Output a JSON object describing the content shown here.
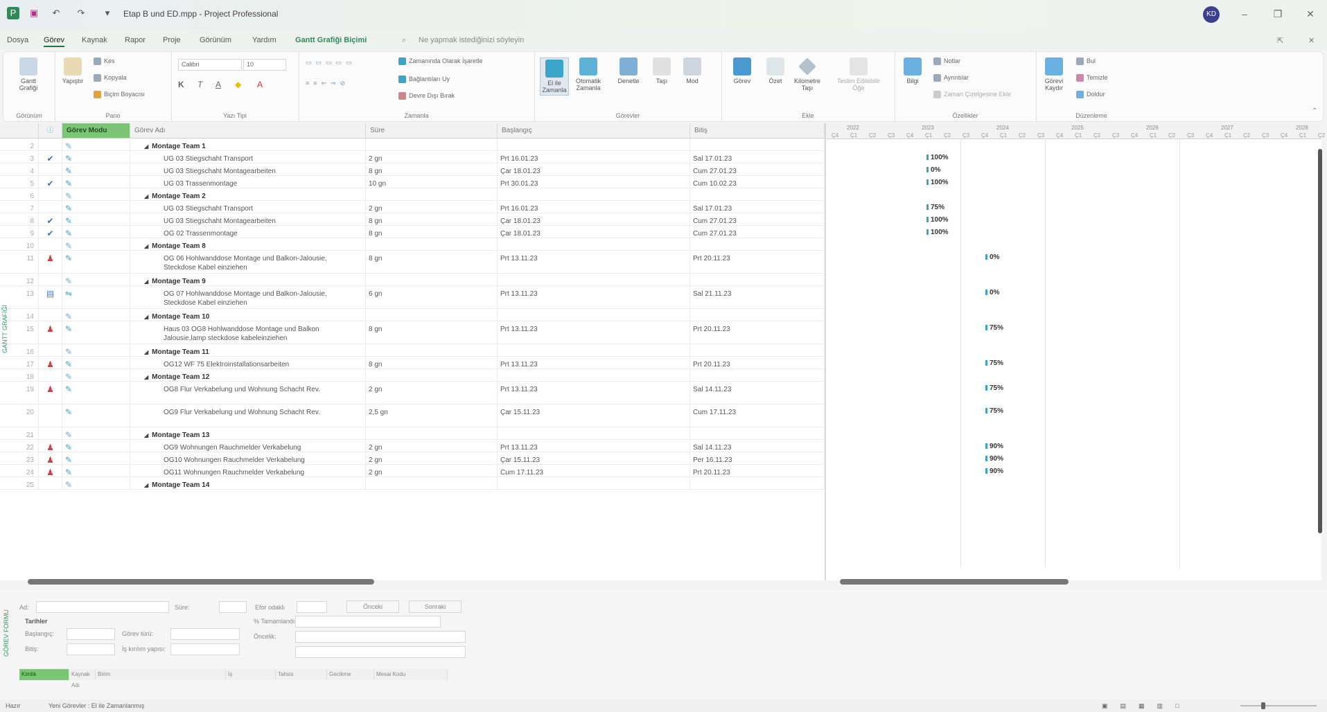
{
  "window": {
    "title": "Etap B und ED.mpp - Project Professional",
    "avatar_initials": "KD"
  },
  "menu": {
    "tabs": [
      "Dosya",
      "Görev",
      "Kaynak",
      "Rapor",
      "Proje",
      "Görünüm",
      "Yardım",
      "Gantt Grafiği Biçimi"
    ],
    "search_placeholder": "Ne yapmak istediğinizi söyleyin"
  },
  "ribbon": {
    "groups": {
      "view": {
        "label": "Görünüm",
        "gantt": "Gantt Grafiği"
      },
      "clipboard": {
        "label": "Pano",
        "paste": "Yapıştır",
        "cut": "Kes",
        "copy": "Kopyala",
        "format_painter": "Biçim Boyacısı"
      },
      "font": {
        "label": "Yazı Tipi",
        "font_name": "Calibri",
        "font_size": "10"
      },
      "schedule": {
        "label": "Zamanla",
        "respect_links": "Zamanında Olarak İşaretle",
        "link": "Bağlantıları Uy",
        "inactivate": "Devre Dışı Bırak"
      },
      "tasks": {
        "label": "Görevler",
        "manual": "El ile Zamanla",
        "auto": "Otomatik Zamanla",
        "inspect": "Denetle",
        "move": "Taşı",
        "mode": "Mod"
      },
      "insert": {
        "label": "Ekle",
        "task": "Görev",
        "summary": "Özet",
        "milestone": "Kilometre Taşı",
        "deliverable": "Teslim Edilebilir Öğe"
      },
      "properties": {
        "label": "Özellikler",
        "info": "Bilgi",
        "notes": "Notlar",
        "details": "Ayrıntılar",
        "add_timeline": "Zaman Çizelgesine Ekle"
      },
      "editing": {
        "label": "Düzenleme",
        "scroll": "Görevi Kaydır",
        "find": "Bul",
        "clear": "Temizle",
        "fill": "Doldur"
      }
    }
  },
  "columns": {
    "mode": "Görev Modu",
    "name": "Görev Adı",
    "duration": "Süre",
    "start": "Başlangıç",
    "finish": "Bitiş"
  },
  "side_label": "GANTT GRAFİĞİ",
  "form_side_label": "GÖREV FORMU",
  "rows": [
    {
      "num": "2",
      "ind": "",
      "summary": true,
      "name": "Montage Team 1",
      "dur": "",
      "start": "",
      "finish": "",
      "pct": ""
    },
    {
      "num": "3",
      "ind": "check",
      "summary": false,
      "name": "UG 03 Stiegschaht Transport",
      "dur": "2 gn",
      "start": "Prt 16.01.23",
      "finish": "Sal 17.01.23",
      "pct": "100%"
    },
    {
      "num": "4",
      "ind": "",
      "summary": false,
      "name": "UG 03 Stiegschaht Montagearbeiten",
      "dur": "8 gn",
      "start": "Çar 18.01.23",
      "finish": "Cum 27.01.23",
      "pct": "0%"
    },
    {
      "num": "5",
      "ind": "check",
      "summary": false,
      "name": "UG 03 Trassenmontage",
      "dur": "10 gn",
      "start": "Prt 30.01.23",
      "finish": "Cum 10.02.23",
      "pct": "100%"
    },
    {
      "num": "6",
      "ind": "",
      "summary": true,
      "name": "Montage Team 2",
      "dur": "",
      "start": "",
      "finish": "",
      "pct": ""
    },
    {
      "num": "7",
      "ind": "",
      "summary": false,
      "name": "UG 03 Stiegschaht Transport",
      "dur": "2 gn",
      "start": "Prt 16.01.23",
      "finish": "Sal 17.01.23",
      "pct": "75%"
    },
    {
      "num": "8",
      "ind": "check",
      "summary": false,
      "name": "UG 03 Stiegschaht Montagearbeiten",
      "dur": "8 gn",
      "start": "Çar 18.01.23",
      "finish": "Cum 27.01.23",
      "pct": "100%"
    },
    {
      "num": "9",
      "ind": "check",
      "summary": false,
      "name": "OG 02 Trassenmontage",
      "dur": "8 gn",
      "start": "Çar 18.01.23",
      "finish": "Cum 27.01.23",
      "pct": "100%"
    },
    {
      "num": "10",
      "ind": "",
      "summary": true,
      "name": "Montage Team 8",
      "dur": "",
      "start": "",
      "finish": "",
      "pct": ""
    },
    {
      "num": "11",
      "ind": "person",
      "summary": false,
      "name": "OG 06 Hohlwanddose Montage und Balkon-Jalousie, Steckdose Kabel einziehen",
      "dur": "8 gn",
      "start": "Prt 13.11.23",
      "finish": "Prt 20.11.23",
      "pct": "0%",
      "tall": true
    },
    {
      "num": "12",
      "ind": "",
      "summary": true,
      "name": "Montage Team 9",
      "dur": "",
      "start": "",
      "finish": "",
      "pct": ""
    },
    {
      "num": "13",
      "ind": "note",
      "summary": false,
      "name": "OG 07 Hohlwanddose Montage und Balkon-Jalousie, Steckdose Kabel einziehen",
      "dur": "6 gn",
      "start": "Prt 13.11.23",
      "finish": "Sal 21.11.23",
      "pct": "0%",
      "tall": true
    },
    {
      "num": "14",
      "ind": "",
      "summary": true,
      "name": "Montage Team 10",
      "dur": "",
      "start": "",
      "finish": "",
      "pct": ""
    },
    {
      "num": "15",
      "ind": "person",
      "summary": false,
      "name": "Haus 03 OG8 Hohlwanddose Montage und Balkon Jalousie,lamp steckdose kabeleinziehen",
      "dur": "8 gn",
      "start": "Prt 13.11.23",
      "finish": "Prt 20.11.23",
      "pct": "75%",
      "tall": true
    },
    {
      "num": "16",
      "ind": "",
      "summary": true,
      "name": "Montage Team 11",
      "dur": "",
      "start": "",
      "finish": "",
      "pct": ""
    },
    {
      "num": "17",
      "ind": "person",
      "summary": false,
      "name": "OG12 WF 75 Elektroinstallationsarbeiten",
      "dur": "8 gn",
      "start": "Prt 13.11.23",
      "finish": "Prt 20.11.23",
      "pct": "75%"
    },
    {
      "num": "18",
      "ind": "",
      "summary": true,
      "name": "Montage Team 12",
      "dur": "",
      "start": "",
      "finish": "",
      "pct": ""
    },
    {
      "num": "19",
      "ind": "person",
      "summary": false,
      "name": "OG8 Flur Verkabelung und Wohnung Schacht Rev.",
      "dur": "2 gn",
      "start": "Prt 13.11.23",
      "finish": "Sal 14.11.23",
      "pct": "75%",
      "tall": true
    },
    {
      "num": "20",
      "ind": "",
      "summary": false,
      "name": "OG9 Flur Verkabelung und Wohnung Schacht Rev.",
      "dur": "2,5 gn",
      "start": "Çar 15.11.23",
      "finish": "Cum 17.11.23",
      "pct": "75%",
      "tall": true
    },
    {
      "num": "21",
      "ind": "",
      "summary": true,
      "name": "Montage Team 13",
      "dur": "",
      "start": "",
      "finish": "",
      "pct": ""
    },
    {
      "num": "22",
      "ind": "person",
      "summary": false,
      "name": "OG9 Wohnungen Rauchmelder Verkabelung",
      "dur": "2 gn",
      "start": "Prt 13.11.23",
      "finish": "Sal 14.11.23",
      "pct": "90%"
    },
    {
      "num": "23",
      "ind": "person",
      "summary": false,
      "name": "OG10 Wohnungen Rauchmelder Verkabelung",
      "dur": "2 gn",
      "start": "Çar 15.11.23",
      "finish": "Per 16.11.23",
      "pct": "90%"
    },
    {
      "num": "24",
      "ind": "person",
      "summary": false,
      "name": "OG11 Wohnungen Rauchmelder Verkabelung",
      "dur": "2 gn",
      "start": "Cum 17.11.23",
      "finish": "Prt 20.11.23",
      "pct": "90%"
    },
    {
      "num": "25",
      "ind": "",
      "summary": true,
      "name": "Montage Team 14",
      "dur": "",
      "start": "",
      "finish": "",
      "pct": ""
    }
  ],
  "timescale": {
    "years": [
      "2022",
      "2023",
      "2024",
      "2025",
      "2026",
      "2027",
      "2028"
    ],
    "quarters": [
      "Ç4",
      "Ç1",
      "Ç2",
      "Ç3",
      "Ç4",
      "Ç1",
      "Ç2",
      "Ç3",
      "Ç4",
      "Ç1",
      "Ç2",
      "Ç3",
      "Ç4",
      "Ç1",
      "Ç2",
      "Ç3",
      "Ç4",
      "Ç1",
      "Ç2",
      "Ç3",
      "Ç4",
      "Ç1",
      "Ç2",
      "Ç3",
      "Ç4",
      "Ç1",
      "Ç2",
      "Ç3",
      "Ç4",
      "Ç1"
    ]
  },
  "form": {
    "name_label": "Ad:",
    "duration_label": "Süre:",
    "effort_label": "Efor odaklı",
    "prev_button": "Önceki",
    "next_button": "Sonraki",
    "dates_header": "Tarihler",
    "start_label": "Başlangıç:",
    "finish_label": "Bitiş:",
    "task_type_label": "Görev türü:",
    "pct_label": "% Tamamlandı:",
    "wbs_label": "İş kırılım yapısı:",
    "priority_label": "Öncelik:",
    "columns": [
      "Kimlik",
      "Kaynak Adı",
      "Birim",
      "İş",
      "Tahsis",
      "Gecikme",
      "Mesai Kodu"
    ]
  },
  "status": {
    "ready": "Hazır",
    "new_tasks": "Yeni Görevler : El ile Zamanlanmış"
  }
}
